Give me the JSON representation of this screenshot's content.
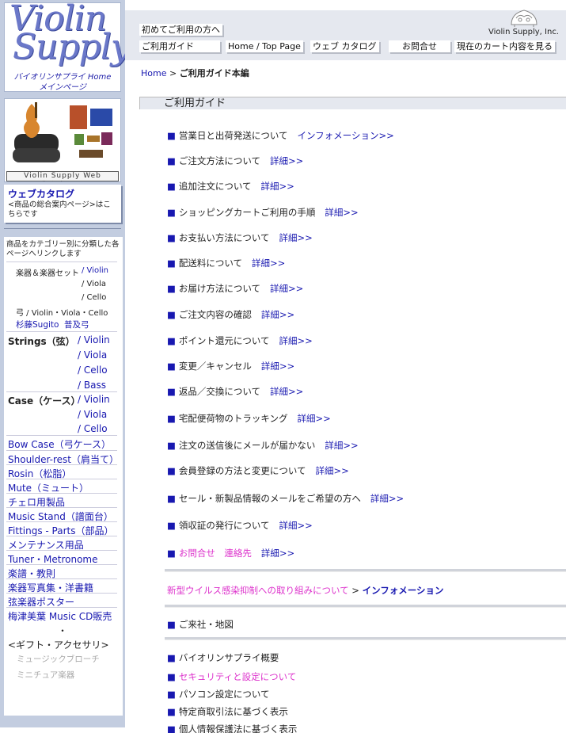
{
  "sidebar": {
    "logo_line1": "Violin",
    "logo_line2": "Supply",
    "logo_sub1": "バイオリンサプライ Home",
    "logo_sub2": "メインページ",
    "catalog_banner": "Violin Supply Web Catalogue",
    "web_catalog_title": "ウェブカタログ",
    "web_catalog_desc": "<商品の総合案内ページ>はこちらです",
    "menu_header": "商品をカテゴリー別に分類した各ページへリンクします",
    "instruments_label": "楽器＆楽器セット",
    "instruments_violin": "/ Violin",
    "instruments_viola": "/ Viola",
    "instruments_cello": "/ Cello",
    "bows_label": "弓 / Violin・Viola・Cello",
    "sugito": "杉藤Sugito",
    "fukyu": "普及弓",
    "strings_label": "Strings（弦）",
    "strings_violin": "/ Violin",
    "strings_viola": "/ Viola",
    "strings_cello": "/ Cello",
    "strings_bass": "/ Bass",
    "case_label": "Case（ケース）",
    "case_violin": "/ Violin",
    "case_viola": "/ Viola",
    "case_cello": "/ Cello",
    "items": [
      "Bow Case（弓ケース）",
      "Shoulder-rest（肩当て）",
      "Rosin（松脂）",
      "Mute（ミュート）",
      "チェロ用製品",
      "Music Stand（譜面台）",
      "Fittings - Parts（部品）",
      "メンテナンス用品",
      "Tuner・Metronome",
      "楽譜・教則",
      "楽器写真集・洋書籍",
      "弦楽器ポスター",
      "梅津美葉 Music CD販売"
    ],
    "dot": "・",
    "gift": "<ギフト・アクセサリ>",
    "brooch": "ミュージックブローチ",
    "miniature": "ミニチュア楽器"
  },
  "topbar": {
    "first_time": "初めてご利用の方へ",
    "guide": "ご利用ガイド",
    "home": "Home / Top Page",
    "web_catalog": "ウェブ カタログ",
    "contact": "お問合せ",
    "cart": "現在のカート内容を見る",
    "brand": "Violin Supply, Inc."
  },
  "breadcrumb": {
    "home": "Home",
    "sep": " > ",
    "current": "ご利用ガイド本編"
  },
  "section_title": "ご利用ガイド",
  "sq": "■",
  "guide_items": [
    {
      "text": "営業日と出荷発送について",
      "link": "インフォメーション>>"
    },
    {
      "text": "ご注文方法について",
      "link": "詳細>>"
    },
    {
      "text": "追加注文について",
      "link": "詳細>>"
    },
    {
      "text": "ショッピングカートご利用の手順",
      "link": "詳細>>"
    },
    {
      "text": "お支払い方法について",
      "link": "詳細>>"
    },
    {
      "text": "配送料について",
      "link": "詳細>>"
    },
    {
      "text": "お届け方法について",
      "link": "詳細>>"
    },
    {
      "text": "ご注文内容の確認",
      "link": "詳細>>"
    },
    {
      "text": "ポイント還元について",
      "link": "詳細>>"
    },
    {
      "text": "変更／キャンセル",
      "link": "詳細>>"
    },
    {
      "text": "返品／交換について",
      "link": "詳細>>"
    },
    {
      "text": "宅配便荷物のトラッキング",
      "link": "詳細>>"
    },
    {
      "text": "注文の送信後にメールが届かない",
      "link": "詳細>>"
    },
    {
      "text": "会員登録の方法と変更について",
      "link": "詳細>>"
    },
    {
      "text": "セール・新製品情報のメールをご希望の方へ",
      "link": "詳細>>"
    },
    {
      "text": "領収証の発行について",
      "link": "詳細>>"
    },
    {
      "text": "お問合せ　連絡先",
      "link": "詳細>>"
    }
  ],
  "covid": {
    "text": "新型ウイルス感染抑制への取り組みについて",
    "sep": " > ",
    "link": "インフォメーション"
  },
  "company_map": "ご来社・地図",
  "bottom_items": [
    "バイオリンサプライ概要",
    "セキュリティと設定について",
    "パソコン設定について",
    "特定商取引法に基づく表示",
    "個人情報保護法に基づく表示"
  ],
  "colors": {
    "link": "#1818b0",
    "pink": "#dd33cc",
    "sidebar_bg": "#c3cde0"
  }
}
